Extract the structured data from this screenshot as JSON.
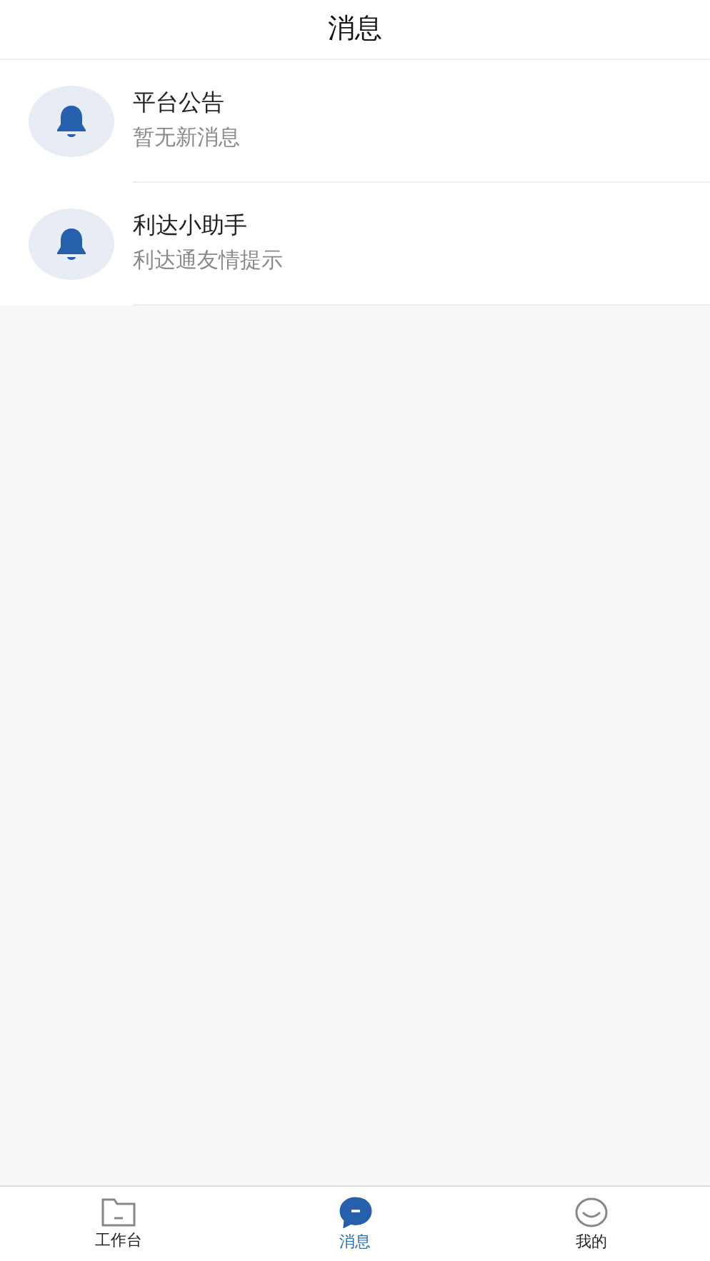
{
  "header": {
    "title": "消息"
  },
  "messages": [
    {
      "title": "平台公告",
      "subtitle": "暂无新消息"
    },
    {
      "title": "利达小助手",
      "subtitle": "利达通友情提示"
    }
  ],
  "tabs": [
    {
      "label": "工作台",
      "kind": "folder",
      "selected": false
    },
    {
      "label": "消息",
      "kind": "chat",
      "selected": true
    },
    {
      "label": "我的",
      "kind": "smile",
      "selected": false
    }
  ]
}
